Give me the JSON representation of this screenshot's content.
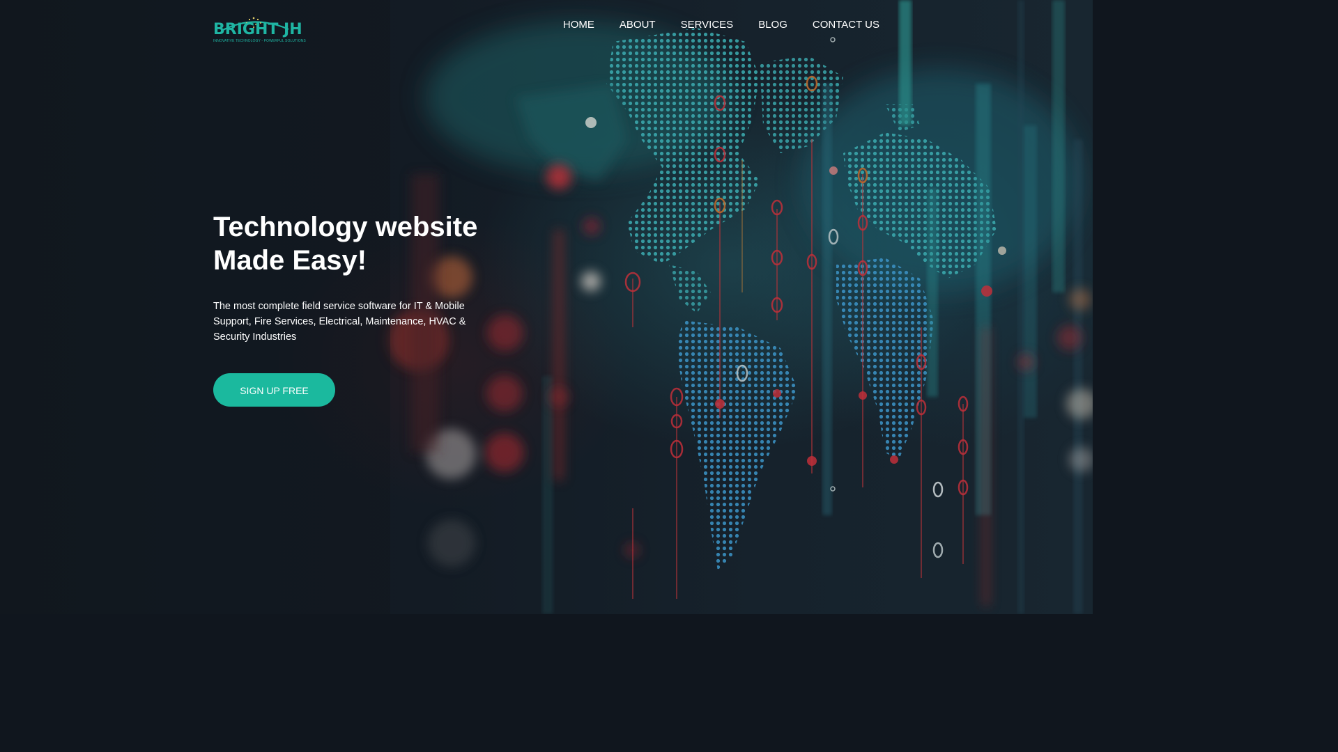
{
  "brand": {
    "name": "BRIGHT JH",
    "tagline": "INNOVATIVE TECHNOLOGY - POWERFUL SOLUTIONS",
    "color": "#1fb5a3"
  },
  "nav": {
    "items": [
      {
        "label": "HOME"
      },
      {
        "label": "ABOUT"
      },
      {
        "label": "SERVICES"
      },
      {
        "label": "BLOG"
      },
      {
        "label": "CONTACT US"
      }
    ]
  },
  "hero": {
    "title_line1": "Technology website",
    "title_line2": "Made Easy!",
    "description": "The most complete field service software for IT & Mobile Support, Fire Services, Electrical, Maintenance, HVAC & Security Industries",
    "cta_label": "SIGN UP FREE",
    "background": "world-map-dots-image"
  },
  "colors": {
    "accent": "#1bb99e",
    "background": "#10161e",
    "map_dots": "#2fa3a8",
    "highlight_red": "#c0262b"
  }
}
